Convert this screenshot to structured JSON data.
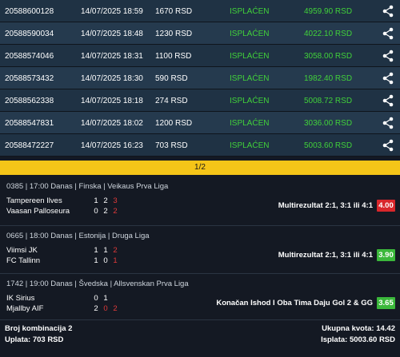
{
  "tickets": [
    {
      "id": "20588600128",
      "datetime": "14/07/2025 18:59",
      "amount": "1670 RSD",
      "status": "ISPLAĆEN",
      "payout": "4959.90 RSD"
    },
    {
      "id": "20588590034",
      "datetime": "14/07/2025 18:48",
      "amount": "1230 RSD",
      "status": "ISPLAĆEN",
      "payout": "4022.10 RSD"
    },
    {
      "id": "20588574046",
      "datetime": "14/07/2025 18:31",
      "amount": "1100 RSD",
      "status": "ISPLAĆEN",
      "payout": "3058.00 RSD"
    },
    {
      "id": "20588573432",
      "datetime": "14/07/2025 18:30",
      "amount": "590 RSD",
      "status": "ISPLAĆEN",
      "payout": "1982.40 RSD"
    },
    {
      "id": "20588562338",
      "datetime": "14/07/2025 18:18",
      "amount": "274 RSD",
      "status": "ISPLAĆEN",
      "payout": "5008.72 RSD"
    },
    {
      "id": "20588547831",
      "datetime": "14/07/2025 18:02",
      "amount": "1200 RSD",
      "status": "ISPLAĆEN",
      "payout": "3036.00 RSD"
    },
    {
      "id": "20588472227",
      "datetime": "14/07/2025 16:23",
      "amount": "703 RSD",
      "status": "ISPLAĆEN",
      "payout": "5003.60 RSD"
    }
  ],
  "pager": {
    "label": "1/2"
  },
  "events": [
    {
      "header": "0385 | 17:00 Danas | Finska | Veikaus Prva Liga",
      "home": "Tampereen Ilves",
      "away": "Vaasan Palloseura",
      "home_scores": [
        "1",
        "2",
        "3"
      ],
      "away_scores": [
        "0",
        "2",
        "2"
      ],
      "pick": "Multirezultat 2:1, 3:1 ili 4:1",
      "odds": "4.00",
      "odds_color": "#d8262b"
    },
    {
      "header": "0665 | 18:00 Danas | Estonija | Druga Liga",
      "home": "Viimsi JK",
      "away": "FC Tallinn",
      "home_scores": [
        "1",
        "1",
        "2"
      ],
      "away_scores": [
        "1",
        "0",
        "1"
      ],
      "pick": "Multirezultat 2:1, 3:1 ili 4:1",
      "odds": "3.90",
      "odds_color": "#3bb83b"
    },
    {
      "header": "1742 | 19:00 Danas | Švedska | Allsvenskan Prva Liga",
      "home": "IK Sirius",
      "away": "Mjallby AIF",
      "home_scores": [
        "0",
        "1"
      ],
      "away_scores": [
        "2",
        "0",
        "2"
      ],
      "pick": "Konačan Ishod I Oba Tima Daju Gol 2 & GG",
      "odds": "3.65",
      "odds_color": "#3bb83b"
    }
  ],
  "footer": {
    "combinations": "Broj kombinacija 2",
    "stake": "Uplata: 703 RSD",
    "total_odds": "Ukupna kvota: 14.42",
    "payout": "Isplata: 5003.60 RSD"
  }
}
